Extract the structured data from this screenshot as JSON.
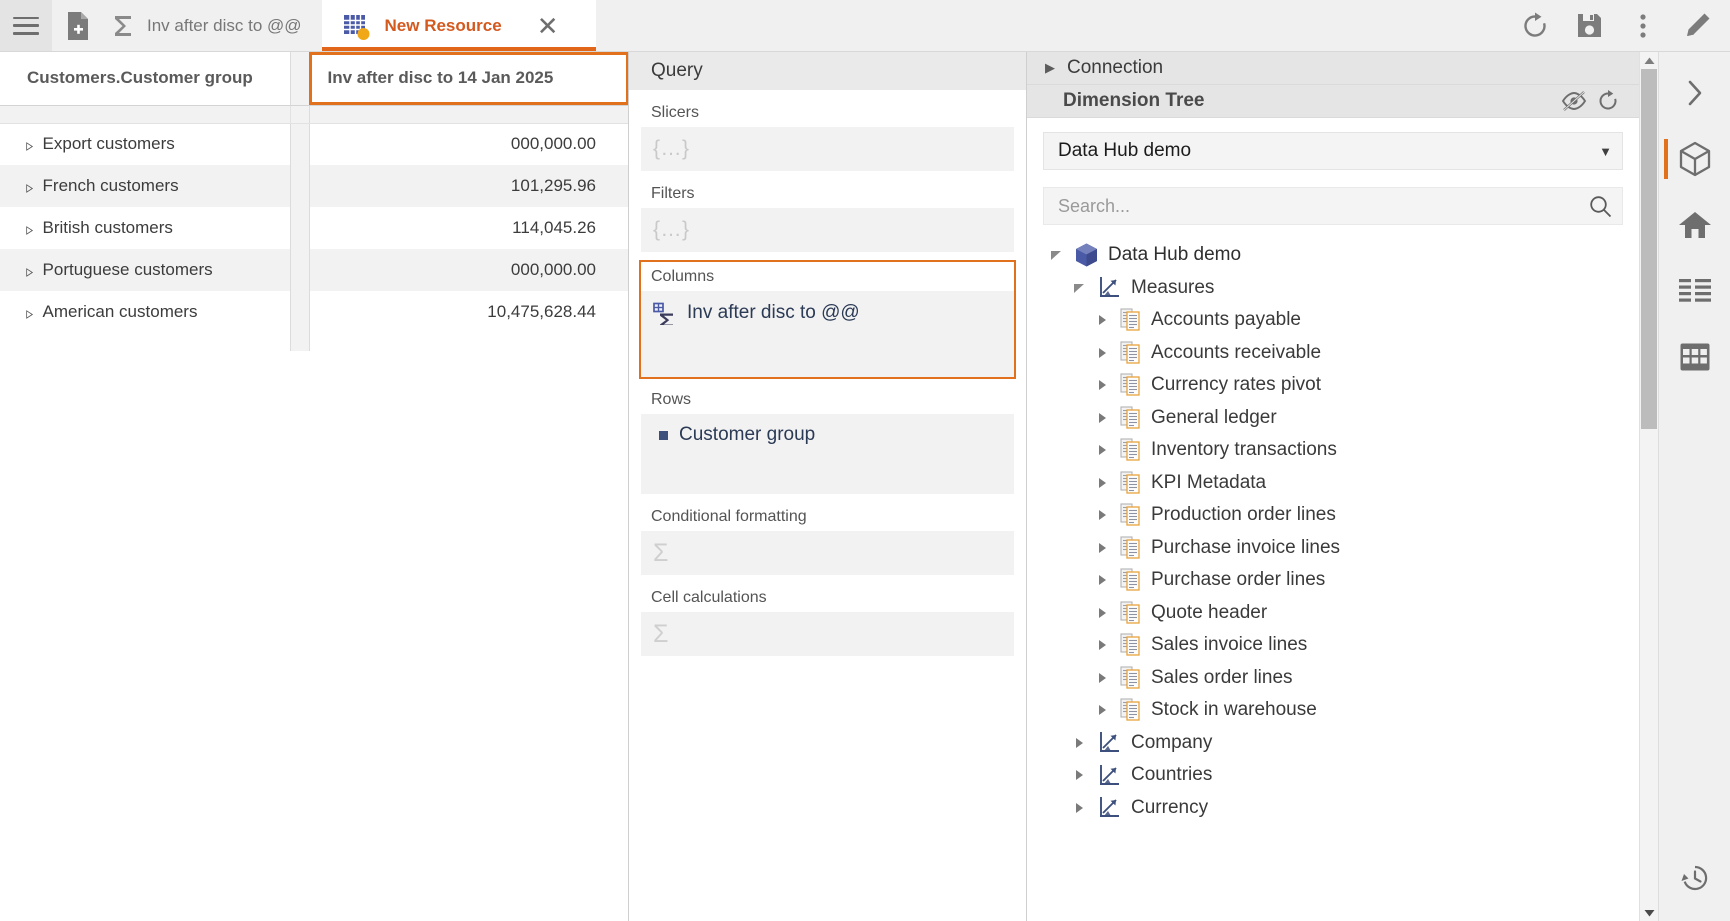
{
  "topbar": {
    "menu_icon": "hamburger-icon",
    "new_doc_icon": "new-document-icon",
    "tabs": [
      {
        "icon": "sigma-icon",
        "label": "Inv after disc to @@",
        "active": false
      },
      {
        "icon": "pivot-grid-icon",
        "label": "New Resource",
        "active": true,
        "close": "✕"
      }
    ],
    "actions": [
      {
        "icon": "refresh-icon",
        "name": "refresh-button"
      },
      {
        "icon": "save-icon",
        "name": "save-button"
      },
      {
        "icon": "more-vertical-icon",
        "name": "more-options-button"
      },
      {
        "icon": "pencil-icon",
        "name": "edit-button"
      }
    ]
  },
  "pivot": {
    "row_header": "Customers.Customer group",
    "value_header": "Inv after disc to 14 Jan 2025",
    "rows": [
      {
        "label": "Export customers",
        "value": "000,000.00"
      },
      {
        "label": "French customers",
        "value": "101,295.96"
      },
      {
        "label": "British customers",
        "value": "114,045.26"
      },
      {
        "label": "Portuguese customers",
        "value": "000,000.00"
      },
      {
        "label": "American customers",
        "value": "10,475,628.44"
      }
    ],
    "expander_glyph": "▹"
  },
  "query": {
    "title": "Query",
    "groups": [
      {
        "label": "Slicers",
        "placeholder": "{…}",
        "kind": "braces",
        "highlight": false
      },
      {
        "label": "Filters",
        "placeholder": "{…}",
        "kind": "braces",
        "highlight": false
      },
      {
        "label": "Columns",
        "kind": "item",
        "item": "Inv after disc to @@",
        "item_icon": "measure-sigma-icon",
        "highlight": true
      },
      {
        "label": "Rows",
        "kind": "item",
        "item": "Customer group",
        "item_icon": "dimension-square-icon",
        "highlight": false
      },
      {
        "label": "Conditional formatting",
        "placeholder": "Σ",
        "kind": "sigma",
        "highlight": false
      },
      {
        "label": "Cell calculations",
        "placeholder": "Σ",
        "kind": "sigma",
        "highlight": false
      }
    ]
  },
  "right_panel": {
    "connection_label": "Connection",
    "dimension_tree_label": "Dimension Tree",
    "hide_icon": "eye-slash-icon",
    "refresh_icon": "refresh-icon",
    "cube_selected": "Data Hub demo",
    "search_placeholder": "Search...",
    "search_value": "",
    "search_icon": "search-icon",
    "tree": [
      {
        "depth": 0,
        "label": "Data Hub demo",
        "icon": "cube-icon",
        "state": "expanded"
      },
      {
        "depth": 1,
        "label": "Measures",
        "icon": "folder-measures-icon",
        "state": "expanded"
      },
      {
        "depth": 2,
        "label": "Accounts payable",
        "icon": "measure-group-icon",
        "state": "collapsed"
      },
      {
        "depth": 2,
        "label": "Accounts receivable",
        "icon": "measure-group-icon",
        "state": "collapsed"
      },
      {
        "depth": 2,
        "label": "Currency rates pivot",
        "icon": "measure-group-icon",
        "state": "collapsed"
      },
      {
        "depth": 2,
        "label": "General ledger",
        "icon": "measure-group-icon",
        "state": "collapsed"
      },
      {
        "depth": 2,
        "label": "Inventory transactions",
        "icon": "measure-group-icon",
        "state": "collapsed"
      },
      {
        "depth": 2,
        "label": "KPI Metadata",
        "icon": "measure-group-icon",
        "state": "collapsed"
      },
      {
        "depth": 2,
        "label": "Production order lines",
        "icon": "measure-group-icon",
        "state": "collapsed"
      },
      {
        "depth": 2,
        "label": "Purchase invoice lines",
        "icon": "measure-group-icon",
        "state": "collapsed"
      },
      {
        "depth": 2,
        "label": "Purchase order lines",
        "icon": "measure-group-icon",
        "state": "collapsed"
      },
      {
        "depth": 2,
        "label": "Quote header",
        "icon": "measure-group-icon",
        "state": "collapsed"
      },
      {
        "depth": 2,
        "label": "Sales invoice lines",
        "icon": "measure-group-icon",
        "state": "collapsed"
      },
      {
        "depth": 2,
        "label": "Sales order lines",
        "icon": "measure-group-icon",
        "state": "collapsed"
      },
      {
        "depth": 2,
        "label": "Stock in warehouse",
        "icon": "measure-group-icon",
        "state": "collapsed"
      },
      {
        "depth": 1,
        "label": "Company",
        "icon": "dimension-axes-icon",
        "state": "collapsed"
      },
      {
        "depth": 1,
        "label": "Countries",
        "icon": "dimension-axes-icon",
        "state": "collapsed"
      },
      {
        "depth": 1,
        "label": "Currency",
        "icon": "dimension-axes-icon",
        "state": "collapsed"
      }
    ]
  },
  "rail": {
    "items": [
      {
        "icon": "chevron-right-icon",
        "name": "expand-panel-button",
        "active": false
      },
      {
        "icon": "cube-icon",
        "name": "rail-dimension-tree-button",
        "active": true
      },
      {
        "icon": "home-icon",
        "name": "rail-home-button",
        "active": false
      },
      {
        "icon": "list-icon",
        "name": "rail-properties-button",
        "active": false
      },
      {
        "icon": "grid-icon",
        "name": "rail-grid-button",
        "active": false
      }
    ],
    "bottom": {
      "icon": "history-icon",
      "name": "rail-history-button"
    }
  },
  "colors": {
    "accent": "#e2711d",
    "tab_active_text": "#d4591f",
    "tree_blue": "#3d4f7c",
    "doc_orange": "#e8a33d"
  }
}
